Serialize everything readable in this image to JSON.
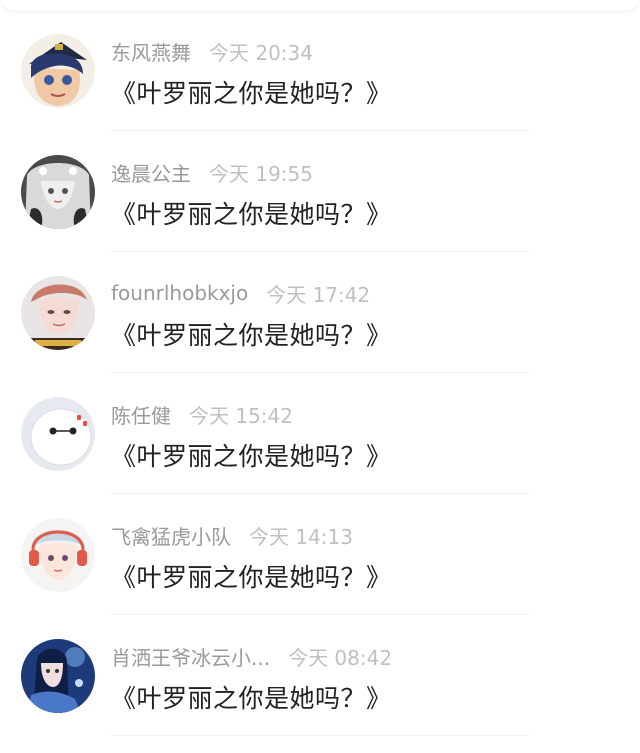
{
  "comments": [
    {
      "name": "东风燕舞",
      "time": "今天 20:34",
      "text": "《叶罗丽之你是她吗？》",
      "avatar_icon": "anime-girl-hat-avatar"
    },
    {
      "name": "逸晨公主",
      "time": "今天 19:55",
      "text": "《叶罗丽之你是她吗？》",
      "avatar_icon": "silver-hair-doll-avatar"
    },
    {
      "name": "founrlhobkxjo",
      "time": "今天 17:42",
      "text": "《叶罗丽之你是她吗？》",
      "avatar_icon": "portrait-photo-avatar"
    },
    {
      "name": "陈任健",
      "time": "今天 15:42",
      "text": "《叶罗丽之你是她吗？》",
      "avatar_icon": "white-robot-avatar"
    },
    {
      "name": "飞禽猛虎小队",
      "time": "今天 14:13",
      "text": "《叶罗丽之你是她吗？》",
      "avatar_icon": "headphones-anime-boy-avatar"
    },
    {
      "name": "肖洒王爷冰云小...",
      "time": "今天 08:42",
      "text": "《叶罗丽之你是她吗？》",
      "avatar_icon": "blue-night-character-avatar"
    }
  ],
  "colors": {
    "name": "#9a9a9a",
    "time": "#c0c0c0",
    "text": "#222222",
    "divider": "#f0f0f0"
  }
}
